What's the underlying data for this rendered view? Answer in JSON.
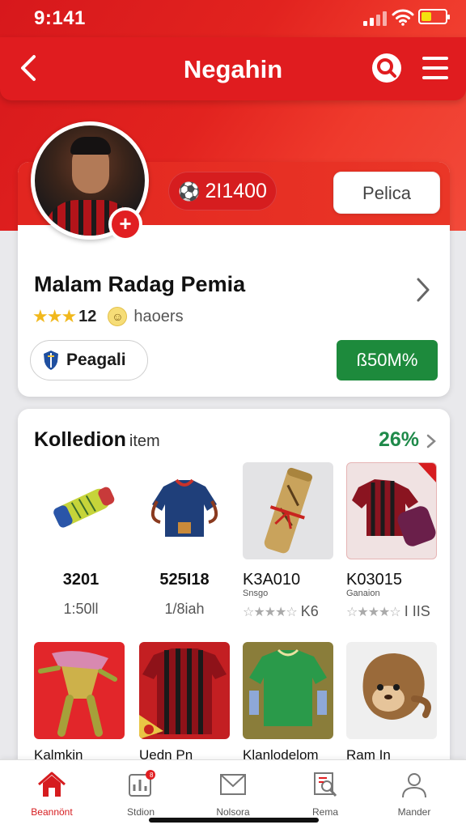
{
  "status_bar": {
    "time": "9:141"
  },
  "header": {
    "title": "Negahin"
  },
  "profile": {
    "coins": "2I1400",
    "follow_label": "Pelica",
    "name": "Malam Radag Pemia",
    "rating_count": "12",
    "rating_text": "haoers",
    "team_label": "Peagali",
    "price_label": "ß50M%"
  },
  "collection": {
    "title": "Kolledion",
    "title_suffix": "item",
    "percent": "26%",
    "items": [
      {
        "line1": "3201",
        "line2": "1:50ll"
      },
      {
        "line1": "525I18",
        "line2": "1/8iah"
      },
      {
        "line1": "K3A010",
        "sub": "Snsgo",
        "line2": "K6"
      },
      {
        "line1": "K03015",
        "sub": "Ganaion",
        "line2": "I IIS"
      },
      {
        "name": "Kalmkin"
      },
      {
        "name": "Uedn Pn"
      },
      {
        "name": "Klanlodelom"
      },
      {
        "name": "Ram In"
      }
    ]
  },
  "bottom_nav": [
    {
      "label": "Beannönt",
      "icon": "home-icon",
      "active": true
    },
    {
      "label": "Stdion",
      "icon": "stats-icon",
      "badge": "8"
    },
    {
      "label": "Nolsora",
      "icon": "envelope-icon"
    },
    {
      "label": "Rema",
      "icon": "search-doc-icon"
    },
    {
      "label": "Mander",
      "icon": "user-icon"
    }
  ],
  "colors": {
    "brand_red": "#e01c1f",
    "accent_green": "#1d8a3c",
    "percent_green": "#1f8a4a"
  }
}
